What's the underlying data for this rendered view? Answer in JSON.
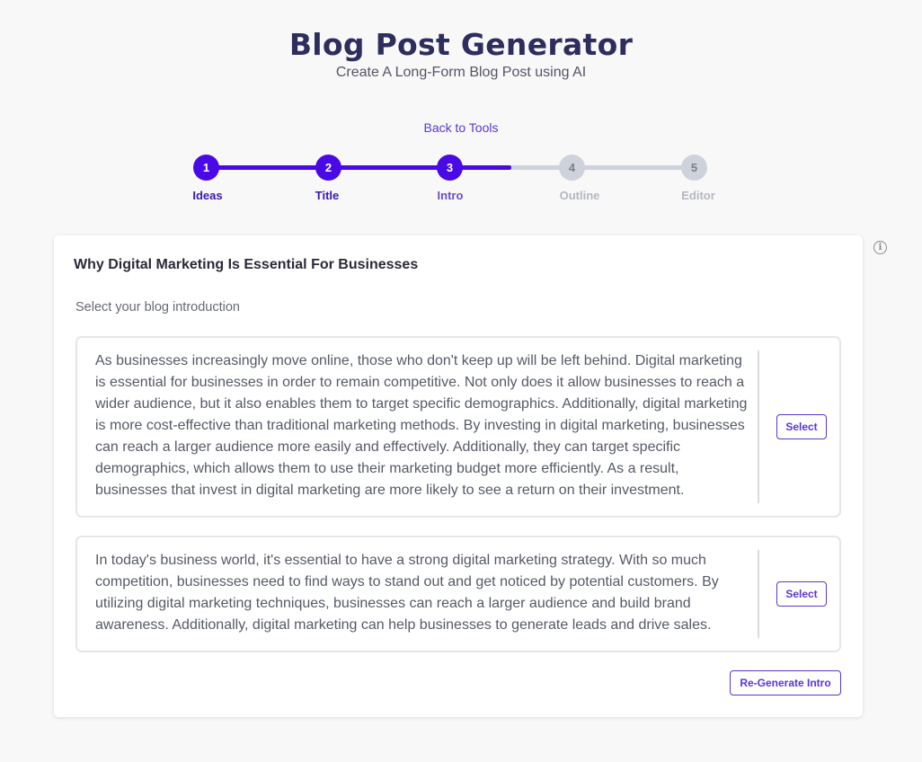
{
  "header": {
    "title": "Blog Post Generator",
    "subtitle": "Create A Long-Form Blog Post using AI",
    "back_link": "Back to Tools"
  },
  "stepper": {
    "steps": [
      {
        "number": "1",
        "label": "Ideas",
        "status": "done"
      },
      {
        "number": "2",
        "label": "Title",
        "status": "done"
      },
      {
        "number": "3",
        "label": "Intro",
        "status": "current"
      },
      {
        "number": "4",
        "label": "Outline",
        "status": "todo"
      },
      {
        "number": "5",
        "label": "Editor",
        "status": "todo"
      }
    ]
  },
  "info_icon": "info-circle-icon",
  "card": {
    "title": "Why Digital Marketing Is Essential For Businesses",
    "hint": "Select your blog introduction",
    "options": [
      {
        "text": "As businesses increasingly move online, those who don't keep up will be left behind. Digital marketing is essential for businesses in order to remain competitive. Not only does it allow businesses to reach a wider audience, but it also enables them to target specific demographics. Additionally, digital marketing is more cost-effective than traditional marketing methods. By investing in digital marketing, businesses can reach a larger audience more easily and effectively. Additionally, they can target specific demographics, which allows them to use their marketing budget more efficiently. As a result, businesses that invest in digital marketing are more likely to see a return on their investment.",
        "select_label": "Select"
      },
      {
        "text": "In today's business world, it's essential to have a strong digital marketing strategy. With so much competition, businesses need to find ways to stand out and get noticed by potential customers. By utilizing digital marketing techniques, businesses can reach a larger audience and build brand awareness. Additionally, digital marketing can help businesses to generate leads and drive sales.",
        "select_label": "Select"
      }
    ],
    "regenerate_label": "Re-Generate Intro"
  },
  "colors": {
    "accent": "#4a0ae6",
    "link": "#5a35d6",
    "title": "#2d2d5e",
    "inactive": "#cdd2db"
  }
}
